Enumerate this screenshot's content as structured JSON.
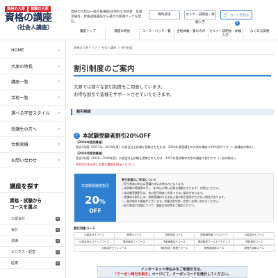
{
  "header": {
    "logo": {
      "badge_left": "資格の大原",
      "badge_right": "就職の大原",
      "title": "資格の講座",
      "subtitle": "（社会人講座）"
    },
    "description": "資格の大原は一部合格講座/圧倒的な合格者、就職実績等、資格試験講座から最大の受講オーナを配信。",
    "buttons": {
      "request": "資料請求",
      "seminar": "セミナー説明会・体験入学",
      "cart": "カートを見る",
      "cart_count": "0"
    },
    "nav": [
      "講座トップ",
      "講座の特長",
      "コース・バッチ一覧",
      "合格体験・書けの声",
      "セミナー説明会・体験入学",
      "よくある質問"
    ]
  },
  "sidebar": {
    "menu": [
      "HOME",
      "大原の特長",
      "講座一覧",
      "学校一覧",
      "選べる学習スタイル",
      "受講生の方へ",
      "合格実績",
      "お問い合わせ"
    ],
    "find_heading": "講座を探す",
    "search_title": "資格・試験から\nコースを選ぶ",
    "checks": [
      "公認会計",
      "会計",
      "法律",
      "ビジネス・経営",
      "医療"
    ]
  },
  "main": {
    "breadcrumb": "資格の大原トップ ＞ 社会人講座 ＞ 割引制度",
    "title": "割引制度のご案内",
    "intro_line1": "大原では様々な割引制度をご用意しています。",
    "intro_line2": "お得な割引で皆様をサポートさせていただきます。",
    "section_label": "割引制度",
    "campaign": {
      "title": "本試験受験者割引20%OFF",
      "block1_head": "【2024年度受講者】",
      "block1_body": "過去2年間（2017年～2019年度）公認会計士試験を受験された方は、2020年度受講生の大原の講座で20%割引です（一部講座対象外）。",
      "block2_head": "【2024年度受講者】",
      "block2_body": "過去2年間（2018～2020年度）公認会計士試験を受験された方は、2021年度試験の大原の講座で割引です（一部対象外）。",
      "note": "※割引は申込時に必要な書類を提出ください。"
    },
    "promo": {
      "banner_line1": "本試験受験者割引",
      "banner_percent": "20",
      "banner_off": "OFF",
      "heading": "割引制度のご利用について",
      "lines": [
        "○割引制度の申込は受講お申込み時のみとなります。",
        "○本試験の受験票の写し（お申込の際に必要な書類となります）を提出ください。",
        "○本試験受験割引は、他の割引制度と併用できない場合があります。",
        "○受講料の割引には、前期受講料をお支払い後の割引適用ができない場合があります。",
        "○一部対象外の講座がございます。詳細は各学校・校舎へお問い合わせください。",
        "○割引制度の詳細について、講座の内容等をご確認ください。"
      ]
    },
    "course_label": "割引対象コース",
    "courses": [
      "公認会計士コース",
      "税理士コース",
      "簿記検定コース",
      "財務諸表論コースパック",
      "公認会計士コース",
      "公認会計士ステップコース",
      "簿記検定ワンコース",
      "不動産鑑定士コース",
      "簿記検定ワールドアドバンス",
      "簿記検定コース",
      "公認会計士ワンコース",
      "簿記検定・税理士コース",
      "財務諸表論コース",
      "税理士試験コース"
    ],
    "notice_line1": "インターネット申込みをご希望の方は、",
    "notice_line2_red": "「クーポン発行手続き」",
    "notice_line2_rest": "ページにて、クーポンコードを発行してください。"
  }
}
